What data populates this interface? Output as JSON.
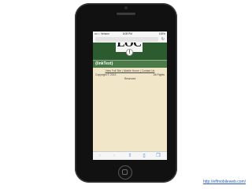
{
  "statusbar": {
    "carrier": "•••○○ Verizon",
    "time": "8:05 PM",
    "battery": "100%"
  },
  "urlbar": {
    "reload_icon": "reload-icon"
  },
  "header": {
    "logo_text": "LOC",
    "alert_icon": "!"
  },
  "linkbar": {
    "label": "{linkText}"
  },
  "footer": {
    "links": "View Full Site | Mobile Home | Contact Us",
    "copyright": "Copyright © 2013",
    "rights": "All Rights",
    "reserved": "Reserved"
  },
  "toolbar": {
    "back": "‹",
    "forward": "›",
    "share": "⇧",
    "bookmarks": "▯",
    "tabs": "❐"
  },
  "credit": {
    "link_text": "http://effmobileweb.com/"
  },
  "colors": {
    "header_green": "#2d5b30",
    "linkbar_green": "#4a7a48",
    "screen_bg": "#f2e6c8",
    "link_blue": "#2f7de1"
  }
}
